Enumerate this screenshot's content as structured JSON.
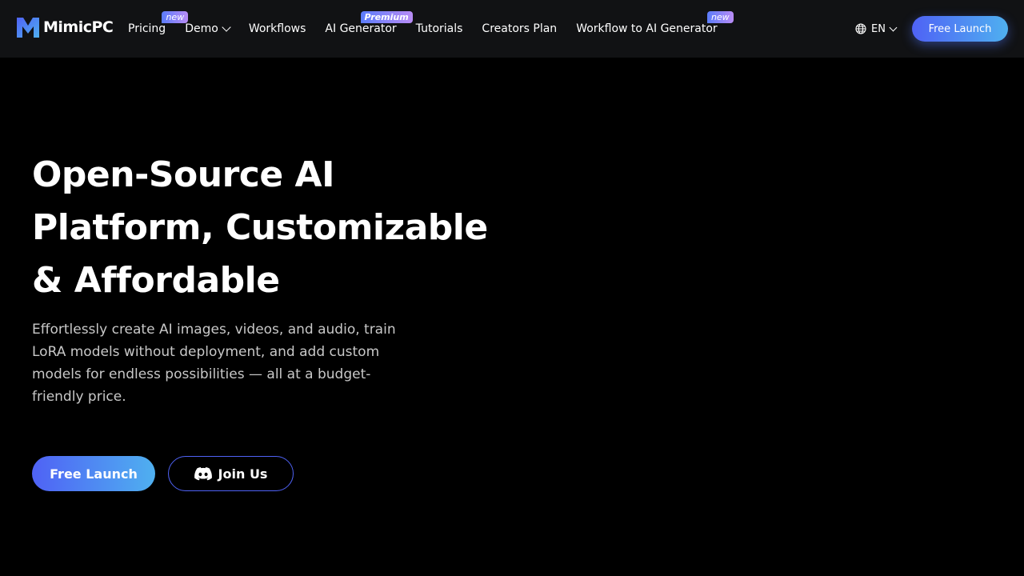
{
  "brand": {
    "name": "MimicPC",
    "logo_icon": "m-logo-icon",
    "accent_start": "#4f62f5",
    "accent_end": "#4fb0f0"
  },
  "nav": {
    "items": [
      {
        "label": "Pricing",
        "badge": "new"
      },
      {
        "label": "Demo"
      },
      {
        "label": "Workflows"
      },
      {
        "label": "AI Generator",
        "badge": "Premium"
      },
      {
        "label": "Tutorials"
      },
      {
        "label": "Creators Plan"
      },
      {
        "label": "Workflow to AI Generator",
        "badge": "new"
      }
    ]
  },
  "language": {
    "label": "EN",
    "icon": "globe-icon"
  },
  "header_cta": {
    "label": "Free Launch"
  },
  "hero": {
    "title_lines": [
      "Open-Source AI",
      "Platform, Customizable",
      "& Affordable"
    ],
    "subtitle": "Effortlessly create AI images, videos, and audio, train LoRA models without deployment, and add custom models for endless possibilities — all at a budget-friendly price.",
    "primary_cta": "Free Launch",
    "secondary_cta": "Join Us",
    "secondary_icon": "discord-icon"
  }
}
